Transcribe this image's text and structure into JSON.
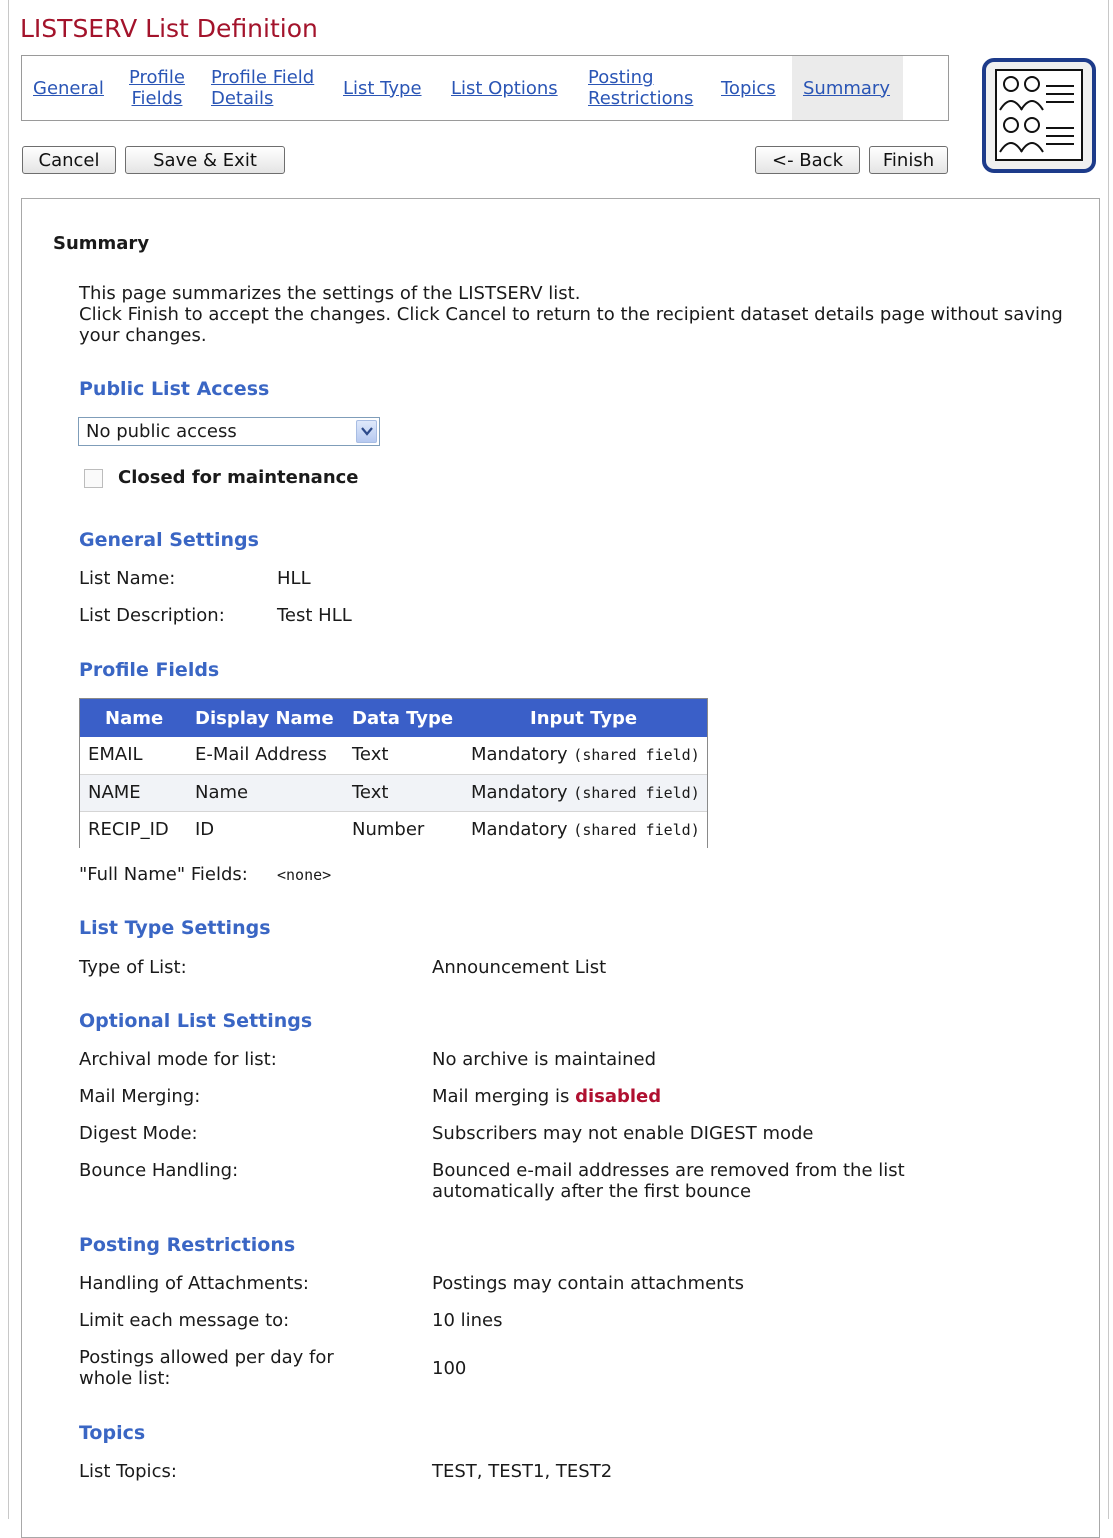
{
  "page": {
    "title": "LISTSERV List Definition"
  },
  "tabs": [
    {
      "label": "General"
    },
    {
      "label1": "Profile",
      "label2": "Fields"
    },
    {
      "label1": "Profile Field",
      "label2": "Details"
    },
    {
      "label": "List Type"
    },
    {
      "label": "List Options"
    },
    {
      "label1": "Posting",
      "label2": "Restrictions"
    },
    {
      "label": "Topics"
    },
    {
      "label": "Summary"
    }
  ],
  "buttons": {
    "cancel": "Cancel",
    "save_exit": "Save & Exit",
    "back": "<- Back",
    "finish": "Finish"
  },
  "summary": {
    "heading": "Summary",
    "intro": [
      "This page summarizes the settings of the LISTSERV list.",
      "Click Finish to accept the changes. Click Cancel to return to the recipient dataset details page without saving your changes."
    ]
  },
  "public_access": {
    "heading": "Public List Access",
    "select_value": "No public access",
    "checkbox_label": "Closed for maintenance",
    "checkbox_checked": false
  },
  "general_settings": {
    "heading": "General Settings",
    "list_name_label": "List Name:",
    "list_name": "HLL",
    "list_description_label": "List Description:",
    "list_description": "Test HLL"
  },
  "profile_fields": {
    "heading": "Profile Fields",
    "columns": [
      "Name",
      "Display Name",
      "Data Type",
      "Input Type"
    ],
    "rows": [
      {
        "name": "EMAIL",
        "display": "E-Mail Address",
        "type": "Text",
        "input": "Mandatory",
        "input_note": "(shared field)"
      },
      {
        "name": "NAME",
        "display": "Name",
        "type": "Text",
        "input": "Mandatory",
        "input_note": "(shared field)"
      },
      {
        "name": "RECIP_ID",
        "display": "ID",
        "type": "Number",
        "input": "Mandatory",
        "input_note": "(shared field)"
      }
    ],
    "full_name_label": "\"Full Name\" Fields:",
    "full_name_value": "<none>"
  },
  "list_type": {
    "heading": "List Type Settings",
    "type_label": "Type of List:",
    "type_value": "Announcement List"
  },
  "optional_settings": {
    "heading": "Optional List Settings",
    "archival_label": "Archival mode for list:",
    "archival_value": "No archive is maintained",
    "merge_label": "Mail Merging:",
    "merge_value_prefix": "Mail merging is",
    "merge_value_state": "disabled",
    "digest_label": "Digest Mode:",
    "digest_value": "Subscribers may not enable DIGEST mode",
    "bounce_label": "Bounce Handling:",
    "bounce_value_1": "Bounced e-mail addresses are removed from the list",
    "bounce_value_2": "automatically after the first bounce"
  },
  "posting_restrictions": {
    "heading": "Posting Restrictions",
    "attachments_label": "Handling of Attachments:",
    "attachments_value": "Postings may contain attachments",
    "limit_label": "Limit each message to:",
    "limit_value": "10 lines",
    "per_day_label_1": "Postings allowed per day for",
    "per_day_label_2": "whole list:",
    "per_day_value": "100"
  },
  "topics": {
    "heading": "Topics",
    "label": "List Topics:",
    "value": "TEST, TEST1, TEST2"
  },
  "colors": {
    "title": "#a3132b",
    "link": "#2a55b5",
    "section": "#3a66c4",
    "table_header": "#3a5fc8",
    "warning": "#b01030"
  }
}
